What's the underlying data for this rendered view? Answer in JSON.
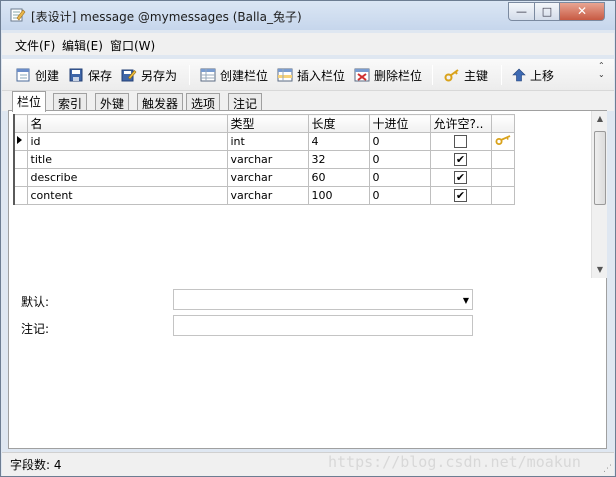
{
  "window": {
    "title": "[表设计] message @mymessages (Balla_兔子)",
    "minimize_glyph": "—",
    "maximize_glyph": "□",
    "close_glyph": "✕"
  },
  "menu": [
    "文件(F)",
    "编辑(E)",
    "窗口(W)"
  ],
  "toolbar": {
    "new": "创建",
    "save": "保存",
    "save_as": "另存为",
    "add_field": "创建栏位",
    "insert_field": "插入栏位",
    "delete_field": "删除栏位",
    "primary_key": "主键",
    "move_up": "上移",
    "more_glyph": "⌃\n⌄"
  },
  "tabs": [
    "栏位",
    "索引",
    "外键",
    "触发器",
    "选项",
    "注记"
  ],
  "grid": {
    "columns": [
      "名",
      "类型",
      "长度",
      "十进位",
      "允许空?.."
    ],
    "rows": [
      {
        "name": "id",
        "type": "int",
        "length": "4",
        "decimals": "0",
        "allow_null": false,
        "primary_key": true,
        "current": true
      },
      {
        "name": "title",
        "type": "varchar",
        "length": "32",
        "decimals": "0",
        "allow_null": true,
        "primary_key": false,
        "current": false
      },
      {
        "name": "describe",
        "type": "varchar",
        "length": "60",
        "decimals": "0",
        "allow_null": true,
        "primary_key": false,
        "current": false
      },
      {
        "name": "content",
        "type": "varchar",
        "length": "100",
        "decimals": "0",
        "allow_null": true,
        "primary_key": false,
        "current": false
      }
    ]
  },
  "properties": {
    "default_label": "默认:",
    "default_value": "",
    "comment_label": "注记:",
    "comment_value": ""
  },
  "status": {
    "field_count": "字段数: 4",
    "watermark": "https://blog.csdn.net/moakun"
  },
  "colors": {
    "window_frame": "#dfe7f1",
    "key_icon": "#d9a21b",
    "close_button": "#c75a43"
  },
  "icons": [
    "table-design-icon",
    "new-icon",
    "save-icon",
    "save-as-icon",
    "add-field-icon",
    "insert-field-icon",
    "delete-field-icon",
    "key-icon",
    "up-arrow-icon"
  ]
}
